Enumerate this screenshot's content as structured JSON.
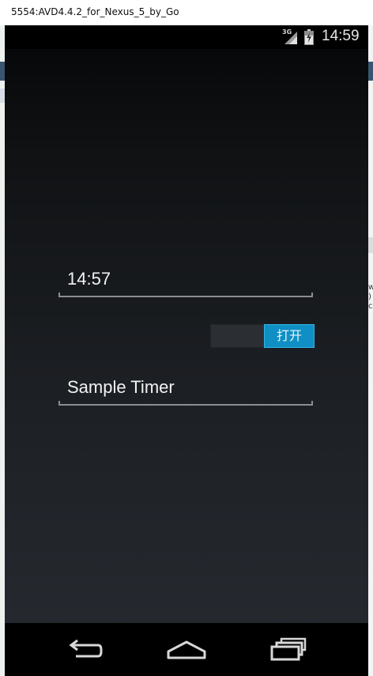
{
  "window": {
    "title": "5554:AVD4.4.2_for_Nexus_5_by_Go"
  },
  "background": {
    "right_glyphs": "w\n)\nc"
  },
  "statusbar": {
    "network_label": "3G",
    "clock": "14:59",
    "icons": [
      "signal-icon",
      "battery-icon"
    ]
  },
  "form": {
    "time_value": "14:57",
    "toggle_label": "打开",
    "toggle_state": "on",
    "name_value": "Sample Timer"
  },
  "navbar": {
    "buttons": [
      "back-icon",
      "home-icon",
      "recent-apps-icon"
    ]
  },
  "colors": {
    "accent": "#0f8fc4",
    "statusbar": "#000000",
    "text": "#f2f2f2"
  }
}
